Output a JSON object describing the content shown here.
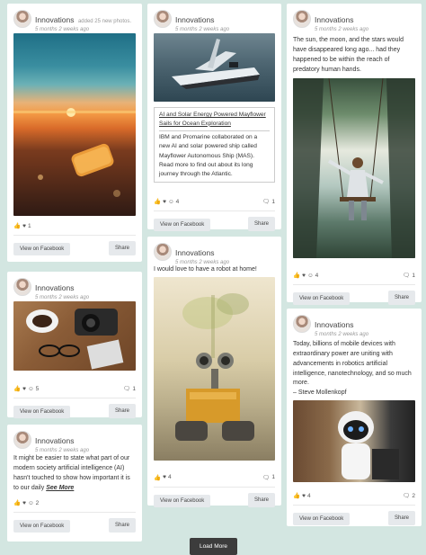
{
  "author": "Innovations",
  "buttons": {
    "view": "View on Facebook",
    "share": "Share",
    "load_more": "Load More"
  },
  "icons": {
    "like": "thumbs-up-icon",
    "love": "heart-icon",
    "wow": "wow-face-icon",
    "comment": "comment-icon"
  },
  "posts": [
    {
      "author": "Innovations",
      "action": "added 25 new photos.",
      "time": "5 months 2 weeks ago",
      "reactions": "1",
      "comments": ""
    },
    {
      "author": "Innovations",
      "time": "5 months 2 weeks ago",
      "text": "",
      "reactions": "5",
      "comments": "1"
    },
    {
      "author": "Innovations",
      "time": "5 months 2 weeks ago",
      "text": "It might be easier to state what part of our modern society artificial intelligence (AI) hasn't touched to show how important it is to our daily",
      "more": "See More",
      "reactions": "2",
      "comments": ""
    },
    {
      "author": "Innovations",
      "time": "5 months 2 weeks ago",
      "link_title": "AI and Solar Energy Powered Mayflower Sails for Ocean Exploration",
      "link_desc": "IBM and Promarine collaborated on a new AI and solar powered ship called Mayflower Autonomous Ship (MAS). Read more to find out about its long journey through the Atlantic.",
      "reactions": "4",
      "comments": "1"
    },
    {
      "author": "Innovations",
      "time": "5 months 2 weeks ago",
      "text": "I would love to have a robot at home!",
      "reactions": "4",
      "comments": "1"
    },
    {
      "author": "Innovations",
      "time": "5 months 2 weeks ago",
      "text": "The sun, the moon, and the stars would have disappeared long ago... had they happened to be within the reach of predatory human hands.",
      "reactions": "4",
      "comments": "1"
    },
    {
      "author": "Innovations",
      "time": "5 months 2 weeks ago",
      "text": "Today, billions of mobile devices with extraordinary power are uniting with advancements in robotics artificial intelligence, nanotechnology, and so much more.\n– Steve Mollenkopf",
      "reactions": "4",
      "comments": "2"
    }
  ]
}
